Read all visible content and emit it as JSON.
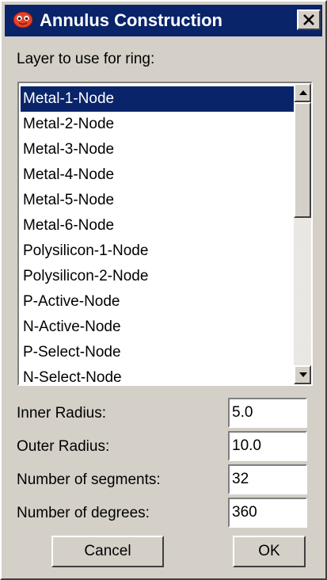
{
  "window": {
    "title": "Annulus Construction",
    "icon": "electric-app-icon",
    "close_icon": "close-icon",
    "accent_color": "#0a246a",
    "background_color": "#d4d0c8"
  },
  "layer_label": "Layer to use for ring:",
  "layers": {
    "items": [
      "Metal-1-Node",
      "Metal-2-Node",
      "Metal-3-Node",
      "Metal-4-Node",
      "Metal-5-Node",
      "Metal-6-Node",
      "Polysilicon-1-Node",
      "Polysilicon-2-Node",
      "P-Active-Node",
      "N-Active-Node",
      "P-Select-Node",
      "N-Select-Node"
    ],
    "selected": "Metal-1-Node"
  },
  "fields": {
    "inner_radius": {
      "label": "Inner Radius:",
      "value": "5.0"
    },
    "outer_radius": {
      "label": "Outer Radius:",
      "value": "10.0"
    },
    "segments": {
      "label": "Number of segments:",
      "value": "32"
    },
    "degrees": {
      "label": "Number of degrees:",
      "value": "360"
    }
  },
  "buttons": {
    "cancel": "Cancel",
    "ok": "OK"
  }
}
